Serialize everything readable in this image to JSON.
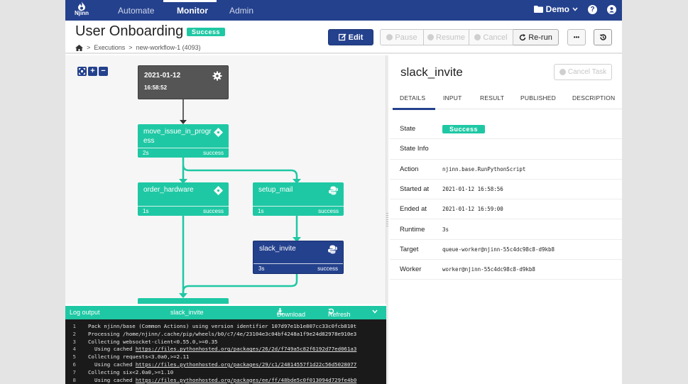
{
  "navbar": {
    "logo_text": "Njinn",
    "items": [
      {
        "label": "Automate",
        "active": false
      },
      {
        "label": "Monitor",
        "active": true
      },
      {
        "label": "Admin",
        "active": false
      }
    ],
    "workspace": "Demo",
    "icons": [
      "folder-icon",
      "chevron-down-icon",
      "help-icon",
      "user-icon"
    ]
  },
  "header": {
    "title": "User Onboarding",
    "status": "Success",
    "breadcrumb": [
      "Executions",
      "new-workflow-1 (4093)"
    ],
    "buttons": {
      "edit": "Edit",
      "pause": "Pause",
      "resume": "Resume",
      "cancel": "Cancel",
      "rerun": "Re-run",
      "more": "•••"
    }
  },
  "graph": {
    "zoom_controls": [
      "fit-icon",
      "zoom-in-icon",
      "zoom-out-icon"
    ],
    "start_node": {
      "date": "2021-01-12",
      "time": "16:58:52"
    },
    "nodes": [
      {
        "name": "move_issue_in_progress",
        "duration": "2s",
        "status": "success",
        "icon": "diamond-icon",
        "selected": false
      },
      {
        "name": "order_hardware",
        "duration": "1s",
        "status": "success",
        "icon": "diamond-icon",
        "selected": false
      },
      {
        "name": "setup_mail",
        "duration": "1s",
        "status": "success",
        "icon": "python-icon",
        "selected": false
      },
      {
        "name": "slack_invite",
        "duration": "3s",
        "status": "success",
        "icon": "python-icon",
        "selected": true
      }
    ]
  },
  "log": {
    "title": "Log output",
    "task": "slack_invite",
    "download": "Download",
    "refresh": "Refresh",
    "lines": [
      {
        "n": "1",
        "text": "Pack njinn/base (Common Actions) using version identifier 107d97e1b1e807cc33c0fcb810t",
        "indent": false,
        "link": ""
      },
      {
        "n": "2",
        "text": "Processing /home/njinn/.cache/pip/wheels/b0/c7/4e/23104e3c04bf4248a1f9e24d82978e910e3",
        "indent": false,
        "link": ""
      },
      {
        "n": "3",
        "text": "Collecting websocket-client<0.55.0,>=0.35",
        "indent": false,
        "link": ""
      },
      {
        "n": "4",
        "text": "Using cached ",
        "indent": true,
        "link": "https://files.pythonhosted.org/packages/26/2d/f749a5c82f6192d77ed061a3"
      },
      {
        "n": "5",
        "text": "Collecting requests<3.0a0,>=2.11",
        "indent": false,
        "link": ""
      },
      {
        "n": "6",
        "text": "Using cached ",
        "indent": true,
        "link": "https://files.pythonhosted.org/packages/29/c1/24814557f1d22c56d5028077"
      },
      {
        "n": "7",
        "text": "Collecting six<2.0a0,>=1.10",
        "indent": false,
        "link": ""
      },
      {
        "n": "8",
        "text": "Using cached ",
        "indent": true,
        "link": "https://files.pythonhosted.org/packages/ee/ff/48bde5c0f013094d729fe4b0"
      }
    ]
  },
  "detail": {
    "title": "slack_invite",
    "cancel_task": "Cancel Task",
    "tabs": [
      {
        "label": "DETAILS",
        "active": true
      },
      {
        "label": "INPUT",
        "active": false
      },
      {
        "label": "RESULT",
        "active": false
      },
      {
        "label": "PUBLISHED",
        "active": false
      },
      {
        "label": "DESCRIPTION",
        "active": false
      }
    ],
    "rows": [
      {
        "label": "State",
        "value": "Success",
        "badge": true
      },
      {
        "label": "State Info",
        "value": "",
        "badge": false
      },
      {
        "label": "Action",
        "value": "njinn.base.RunPythonScript",
        "badge": false
      },
      {
        "label": "Started at",
        "value": "2021-01-12 16:58:56",
        "badge": false
      },
      {
        "label": "Ended at",
        "value": "2021-01-12 16:59:00",
        "badge": false
      },
      {
        "label": "Runtime",
        "value": "3s",
        "badge": false
      },
      {
        "label": "Target",
        "value": "queue-worker@njinn-55c4dc98c8-d9kb8",
        "badge": false
      },
      {
        "label": "Worker",
        "value": "worker@njinn-55c4dc98c8-d9kb8",
        "badge": false
      }
    ]
  },
  "colors": {
    "brand": "#24418d",
    "success": "#1fc8a4",
    "start_node": "#555555",
    "log_bg": "#1a1a1a"
  }
}
